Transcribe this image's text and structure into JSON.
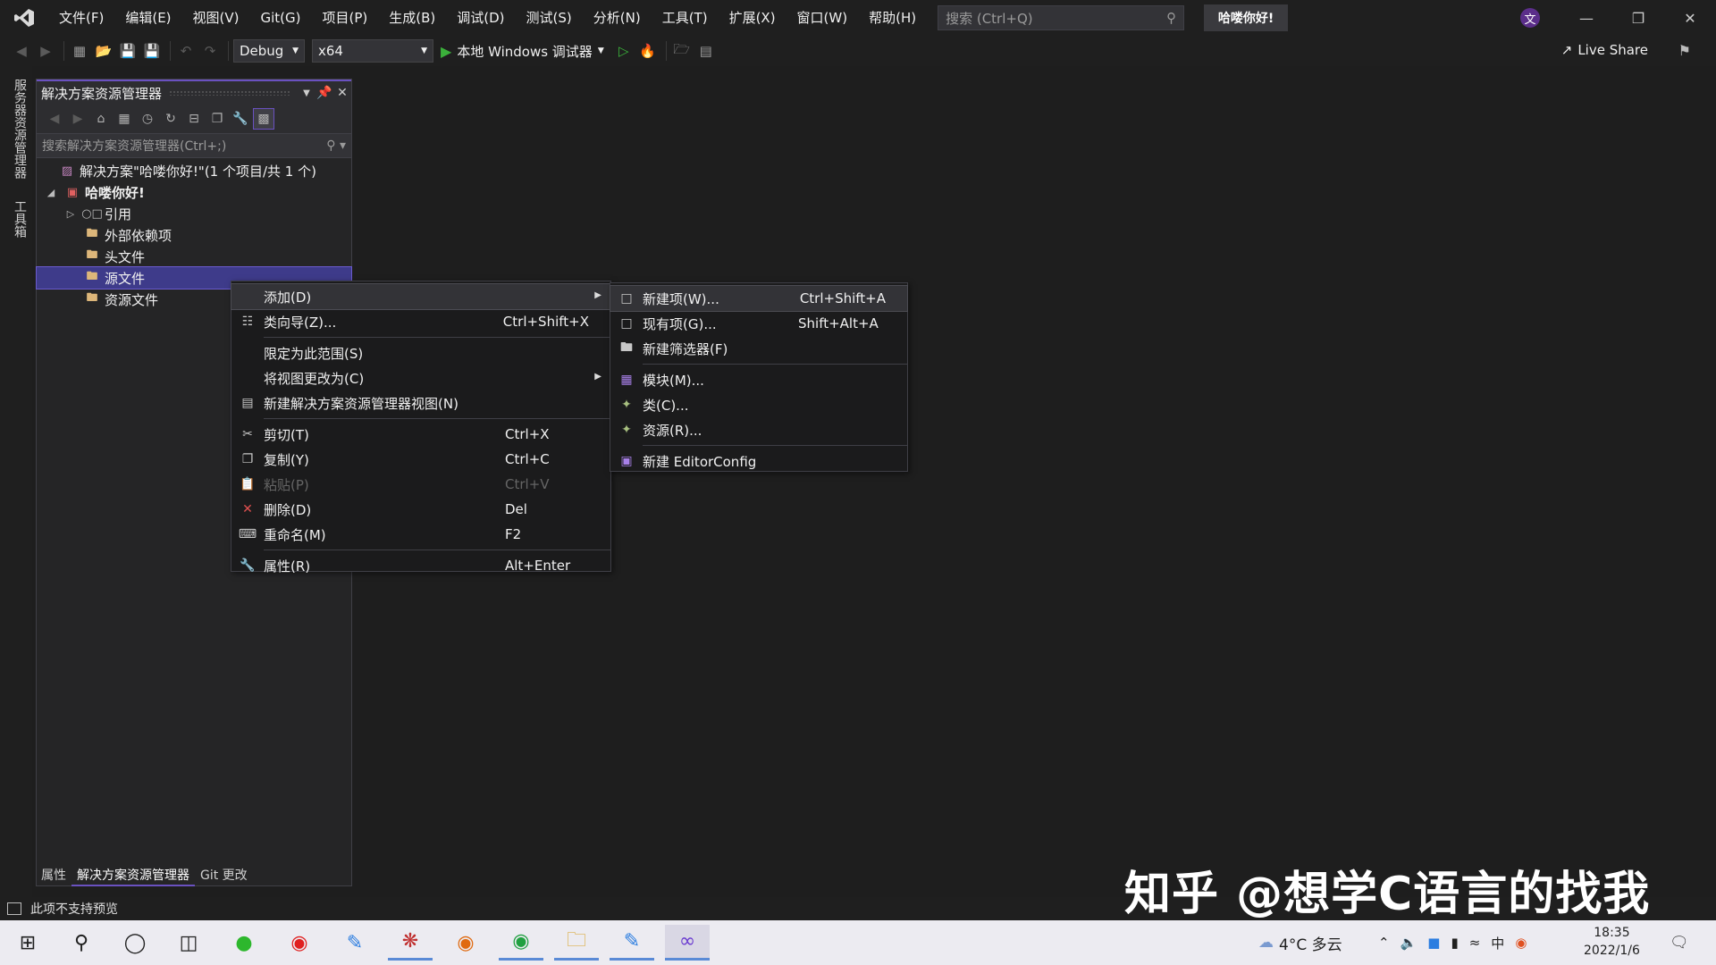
{
  "menubar": {
    "items": [
      "文件(F)",
      "编辑(E)",
      "视图(V)",
      "Git(G)",
      "项目(P)",
      "生成(B)",
      "调试(D)",
      "测试(S)",
      "分析(N)",
      "工具(T)",
      "扩展(X)",
      "窗口(W)",
      "帮助(H)"
    ],
    "search_placeholder": "搜索 (Ctrl+Q)",
    "solution_title": "哈喽你好!",
    "user_initial": "文"
  },
  "toolbar": {
    "config": "Debug",
    "platform": "x64",
    "debugger": "本地 Windows 调试器",
    "live_share": "Live Share"
  },
  "side_tabs": [
    "服务器资源管理器",
    "工具箱"
  ],
  "solution_explorer": {
    "title": "解决方案资源管理器",
    "search_placeholder": "搜索解决方案资源管理器(Ctrl+;)",
    "tree": [
      {
        "label": "解决方案\"哈喽你好!\"(1 个项目/共 1 个)"
      },
      {
        "label": "哈喽你好!"
      },
      {
        "label": "引用"
      },
      {
        "label": "外部依赖项"
      },
      {
        "label": "头文件"
      },
      {
        "label": "源文件"
      },
      {
        "label": "资源文件"
      }
    ],
    "bottom_tabs": [
      "属性",
      "解决方案资源管理器",
      "Git 更改"
    ]
  },
  "context_menu": [
    {
      "label": "添加(D)",
      "shortcut": ""
    },
    {
      "label": "类向导(Z)...",
      "shortcut": "Ctrl+Shift+X"
    },
    {
      "label": "限定为此范围(S)",
      "shortcut": ""
    },
    {
      "label": "将视图更改为(C)",
      "shortcut": ""
    },
    {
      "label": "新建解决方案资源管理器视图(N)",
      "shortcut": ""
    },
    {
      "label": "剪切(T)",
      "shortcut": "Ctrl+X"
    },
    {
      "label": "复制(Y)",
      "shortcut": "Ctrl+C"
    },
    {
      "label": "粘贴(P)",
      "shortcut": "Ctrl+V"
    },
    {
      "label": "删除(D)",
      "shortcut": "Del"
    },
    {
      "label": "重命名(M)",
      "shortcut": "F2"
    },
    {
      "label": "属性(R)",
      "shortcut": "Alt+Enter"
    }
  ],
  "add_submenu": [
    {
      "label": "新建项(W)...",
      "shortcut": "Ctrl+Shift+A"
    },
    {
      "label": "现有项(G)...",
      "shortcut": "Shift+Alt+A"
    },
    {
      "label": "新建筛选器(F)",
      "shortcut": ""
    },
    {
      "label": "模块(M)...",
      "shortcut": ""
    },
    {
      "label": "类(C)...",
      "shortcut": ""
    },
    {
      "label": "资源(R)...",
      "shortcut": ""
    },
    {
      "label": "新建 EditorConfig",
      "shortcut": ""
    }
  ],
  "statusbar": {
    "message": "此项不支持预览"
  },
  "taskbar": {
    "weather": "4°C 多云",
    "time": "18:35",
    "date": "2022/1/6"
  },
  "watermark": "知乎 @想学C语言的找我"
}
